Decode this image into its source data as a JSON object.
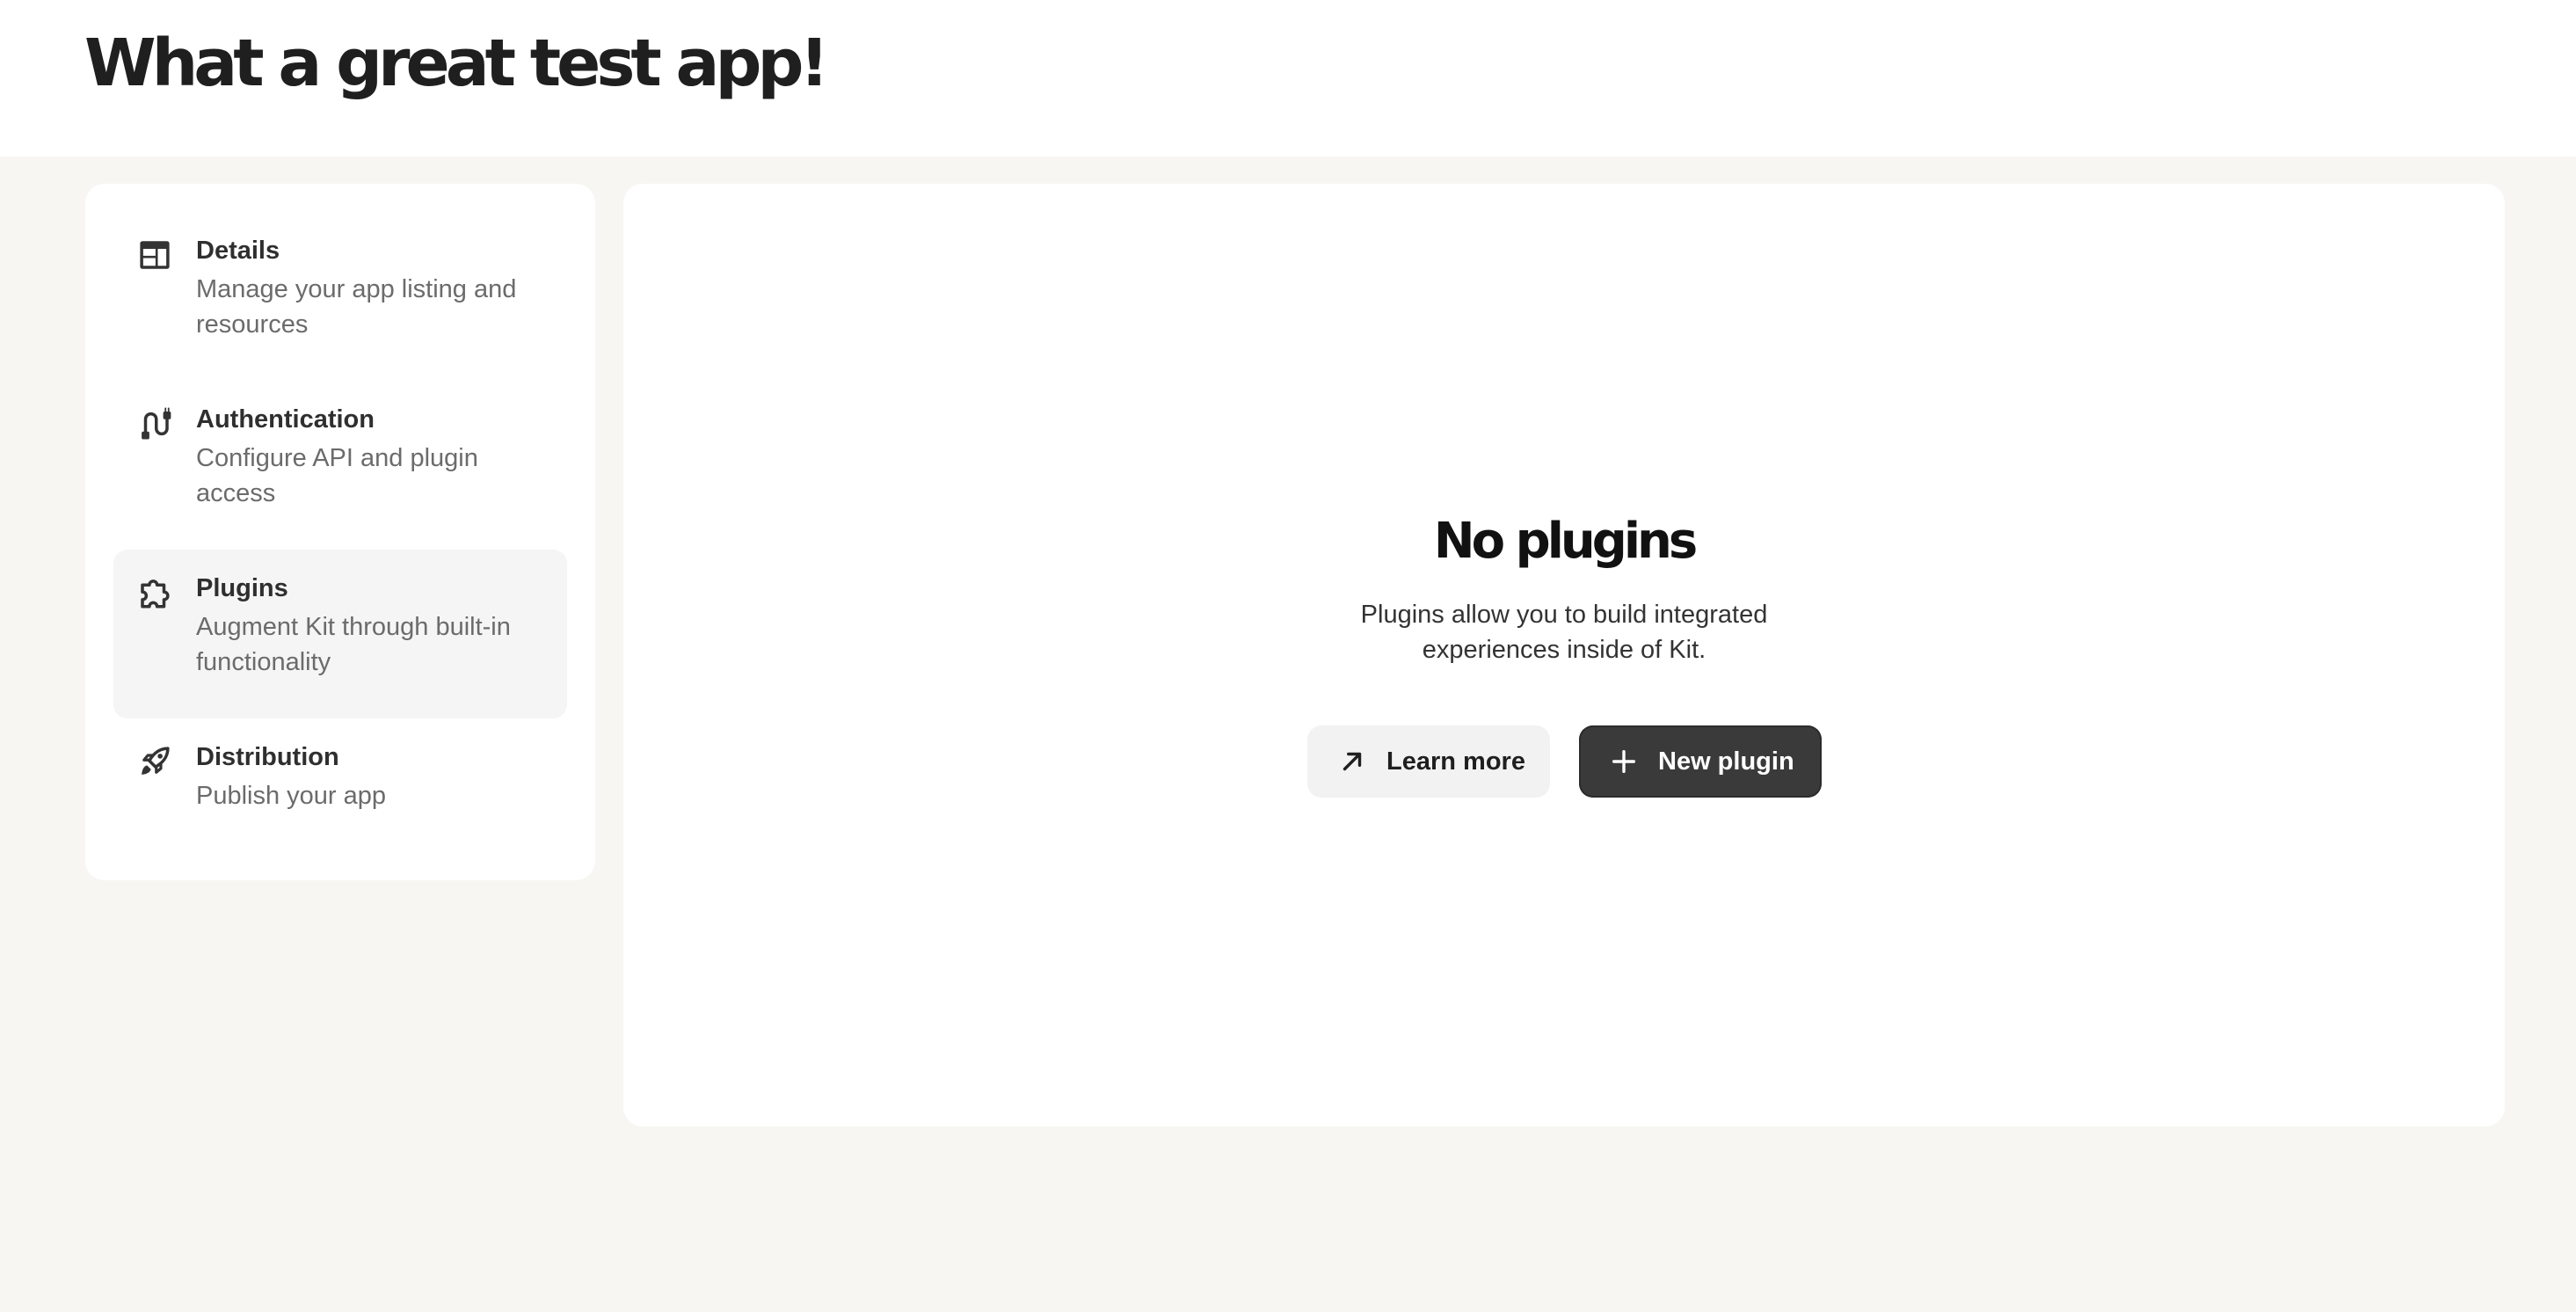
{
  "header": {
    "title": "What a great test app!"
  },
  "sidebar": {
    "items": [
      {
        "label": "Details",
        "description": "Manage your app listing and resources",
        "icon": "layout-icon",
        "active": false
      },
      {
        "label": "Authentication",
        "description": "Configure API and plugin access",
        "icon": "plug-cable-icon",
        "active": false
      },
      {
        "label": "Plugins",
        "description": "Augment Kit through built-in functionality",
        "icon": "puzzle-icon",
        "active": true
      },
      {
        "label": "Distribution",
        "description": "Publish your app",
        "icon": "rocket-icon",
        "active": false
      }
    ]
  },
  "main": {
    "empty_state": {
      "title": "No plugins",
      "description": "Plugins allow you to build integrated experiences inside of Kit.",
      "learn_more_label": "Learn more",
      "learn_more_icon": "arrow-up-right-icon",
      "new_plugin_label": "New plugin",
      "new_plugin_icon": "plus-icon"
    }
  },
  "colors": {
    "page_background": "#f7f6f3",
    "card_background": "#ffffff",
    "active_item_background": "#f5f5f5",
    "primary_button": "#3a3a3a",
    "secondary_button": "#f2f2f2"
  }
}
